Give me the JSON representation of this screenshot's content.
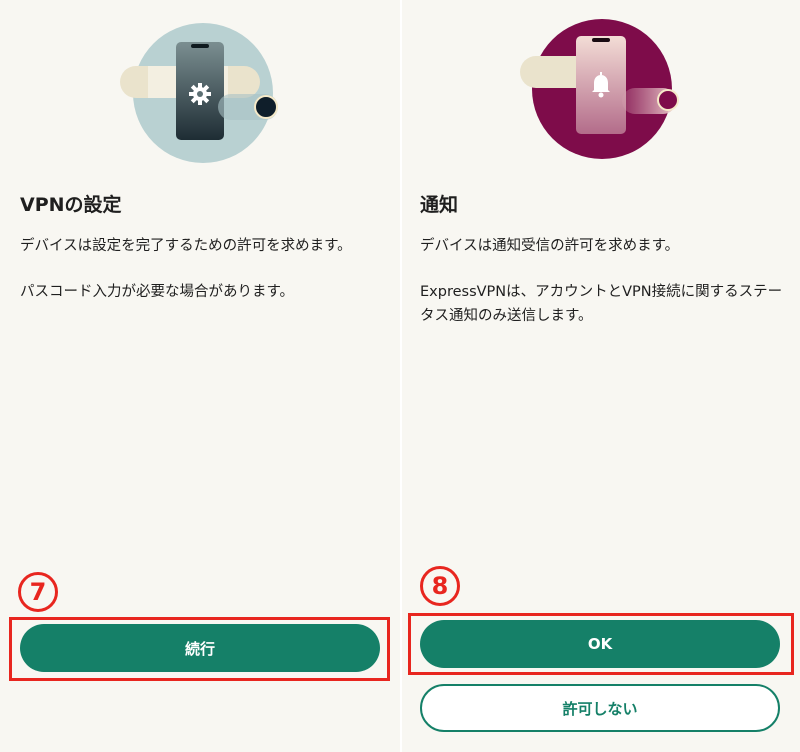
{
  "colors": {
    "background": "#f8f7f2",
    "accent": "#158068",
    "annotation": "#e8261f",
    "settings_circle": "#b9d1d2",
    "notification_circle": "#7e0c4a"
  },
  "left_panel": {
    "illustration_icon": "gear-icon",
    "title": "VPNの設定",
    "paragraph1": "デバイスは設定を完了するための許可を求めます。",
    "paragraph2": "パスコード入力が必要な場合があります。",
    "step_number": "7",
    "primary_button": "続行"
  },
  "right_panel": {
    "illustration_icon": "bell-icon",
    "title": "通知",
    "paragraph1": "デバイスは通知受信の許可を求めます。",
    "paragraph2": "ExpressVPNは、アカウントとVPN接続に関するステータス通知のみ送信します。",
    "step_number": "8",
    "primary_button": "OK",
    "secondary_button": "許可しない"
  }
}
